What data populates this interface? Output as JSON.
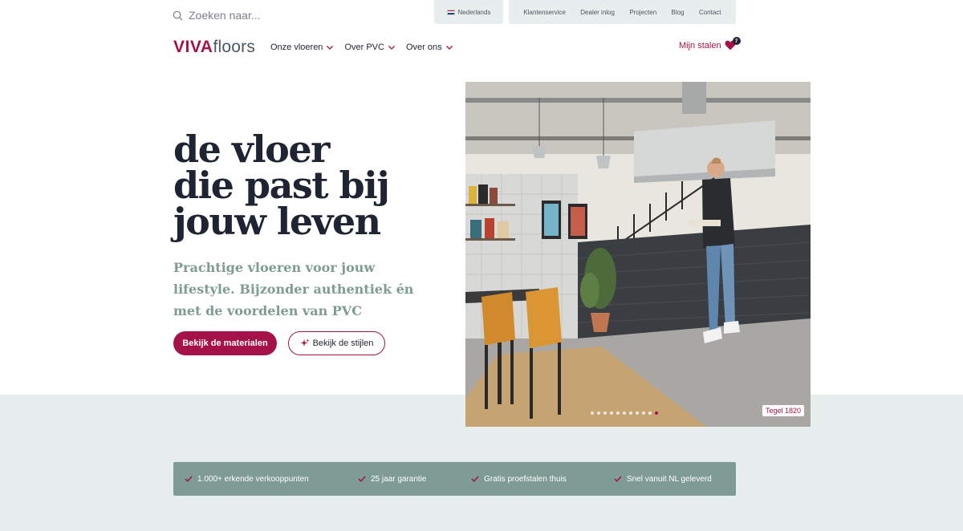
{
  "search": {
    "placeholder": "Zoeken naar..."
  },
  "language": {
    "label": "Nederlands"
  },
  "toplinks": [
    "Klantenservice",
    "Dealer inlog",
    "Projecten",
    "Blog",
    "Contact"
  ],
  "logo": {
    "part1": "VIVA",
    "part2": "floors"
  },
  "mainnav": [
    "Onze vloeren",
    "Over PVC",
    "Over ons"
  ],
  "samples": {
    "label": "Mijn stalen",
    "count": "7"
  },
  "hero": {
    "title_lines": [
      "de vloer",
      "die past bij",
      "jouw leven"
    ],
    "subtitle": "Prachtige vloeren voor jouw lifestyle. Bijzonder authentiek én met de voordelen van PVC",
    "primary_button": "Bekijk de materialen",
    "secondary_button": "Bekijk de stijlen",
    "image_tag": "Tegel 1820",
    "slides_total": 11,
    "slide_active": 11
  },
  "usps": [
    "1.000+ erkende verkooppunten",
    "25 jaar garantie",
    "Gratis proefstalen thuis",
    "Snel vanuit NL geleverd"
  ],
  "colors": {
    "brand": "#a51249",
    "sage": "#7e9b94",
    "light_band": "#e8eeed",
    "ink": "#1f2433"
  }
}
